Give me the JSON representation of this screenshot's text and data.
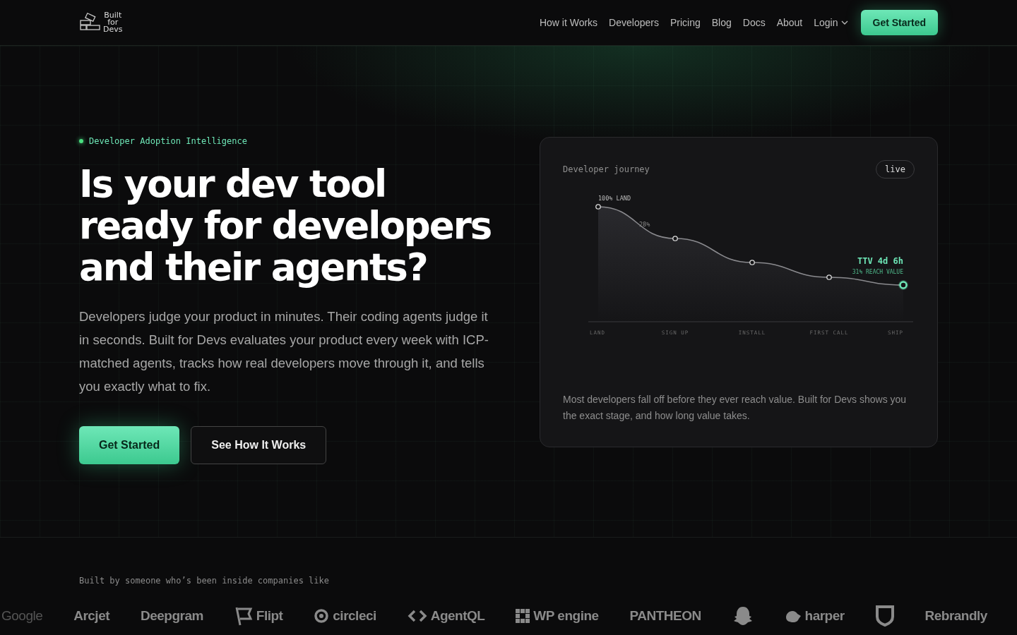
{
  "header": {
    "logo_text": [
      "Built",
      "for",
      "Devs"
    ],
    "nav": [
      {
        "label": "How it Works"
      },
      {
        "label": "Developers"
      },
      {
        "label": "Pricing"
      },
      {
        "label": "Blog"
      },
      {
        "label": "Docs"
      },
      {
        "label": "About"
      },
      {
        "label": "Login",
        "kind": "dropdown"
      }
    ],
    "cta": "Get Started"
  },
  "hero": {
    "eyebrow": "Developer Adoption Intelligence",
    "title": "Is your dev tool ready for developers and their agents?",
    "body": "Developers judge your product in minutes. Their coding agents judge it in seconds. Built for Devs evaluates your product every week with ICP-matched agents, tracks how real developers move through it, and tells you exactly what to fix.",
    "buttons": [
      {
        "label": "Get Started",
        "kind": "primary"
      },
      {
        "label": "See How It Works",
        "kind": "secondary"
      }
    ]
  },
  "journey_card": {
    "title": "Developer journey",
    "badge": "live",
    "annotations": [
      "100% LAND",
      "28%"
    ],
    "highlight": {
      "value": "TTV 4d 6h",
      "caption": "31% REACH VALUE"
    },
    "stages": [
      "LAND",
      "SIGN UP",
      "INSTALL",
      "FIRST CALL",
      "SHIP"
    ],
    "caption": "Most developers fall off before they ever reach value. Built for Devs shows you the exact stage, and how long value takes."
  },
  "companies": {
    "label": "Built by someone who’s been inside companies like",
    "logos": [
      {
        "kind": "word",
        "text": "Google"
      },
      {
        "kind": "word",
        "text": "Arcjet"
      },
      {
        "kind": "word",
        "text": "Deepgram"
      },
      {
        "kind": "flag",
        "text": "Flipt"
      },
      {
        "kind": "ring",
        "text": "circleci"
      },
      {
        "kind": "chevrons",
        "text": "AgentQL"
      },
      {
        "kind": "grid",
        "text": "WP engine"
      },
      {
        "kind": "word",
        "text": "PANTHEON"
      },
      {
        "kind": "ghost"
      },
      {
        "kind": "cloud",
        "text": "harper"
      },
      {
        "kind": "shield"
      },
      {
        "kind": "word",
        "text": "Rebrandly"
      }
    ]
  }
}
